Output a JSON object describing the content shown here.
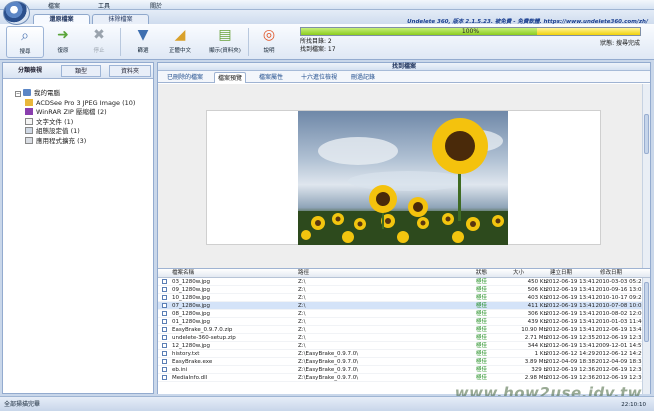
{
  "menu": [
    "檔案",
    "工具",
    "關於"
  ],
  "app_info": "Undelete 360, 版本 2.1.5.23. 被免費 - 免費軟體. https://www.undelete360.com/zh/",
  "tabs": [
    "還原檔案",
    "抹除檔案"
  ],
  "ribbon": {
    "search": "搜尋",
    "recover": "復原",
    "stop": "停止",
    "filter": "篩選",
    "view": "正體中文",
    "folder_structure": "顯示(資料夾)",
    "about": "說明"
  },
  "progress": {
    "percent_label": "100%",
    "value": 1.0
  },
  "status": {
    "folders_label": "所找目錄: 2",
    "files_label": "找到檔案: 17"
  },
  "state_label": "狀態: 搜尋完成",
  "left_panel": {
    "tabs": [
      "分類檢視",
      "類型",
      "資料夾"
    ],
    "tree_root": "我的電腦",
    "tree_items": [
      "ACDSee Pro 3 JPEG Image (10)",
      "WinRAR ZIP 壓縮檔 (2)",
      "文字文件 (1)",
      "組態設定值 (1)",
      "應用程式擴充 (3)"
    ]
  },
  "right_panel": {
    "title": "找到檔案",
    "tabs": [
      "已刪除的檔案",
      "檔案預覽",
      "檔案屬性",
      "十六進位檢視",
      "刪過記錄"
    ]
  },
  "file_list": {
    "columns": [
      "檔案名稱",
      "路徑",
      "狀態",
      "大小",
      "建立日期",
      "修改日期"
    ],
    "rows": [
      [
        "03_1280w.jpg",
        "Z:\\",
        "極佳",
        "450 Kb",
        "2012-06-19 13:41",
        "2010-03-03 05:25"
      ],
      [
        "09_1280w.jpg",
        "Z:\\",
        "極佳",
        "506 Kb",
        "2012-06-19 13:41",
        "2010-09-16 13:03"
      ],
      [
        "10_1280w.jpg",
        "Z:\\",
        "極佳",
        "403 Kb",
        "2012-06-19 13:41",
        "2010-10-17 09:28"
      ],
      [
        "07_1280w.jpg",
        "Z:\\",
        "極佳",
        "411 Kb",
        "2012-06-19 13:41",
        "2010-07-08 10:05"
      ],
      [
        "08_1280w.jpg",
        "Z:\\",
        "極佳",
        "306 Kb",
        "2012-06-19 13:41",
        "2010-08-02 12:00"
      ],
      [
        "01_1280w.jpg",
        "Z:\\",
        "極佳",
        "439 Kb",
        "2012-06-19 13:41",
        "2010-01-03 11:40"
      ],
      [
        "EasyBrake_0.9.7.0.zip",
        "Z:\\",
        "極佳",
        "10.90 Mb",
        "2012-06-19 13:41",
        "2012-06-19 13:41"
      ],
      [
        "undelete-360-setup.zip",
        "Z:\\",
        "極佳",
        "2.71 Mb",
        "2012-06-19 12:35",
        "2012-06-19 12:35"
      ],
      [
        "12_1280w.jpg",
        "Z:\\",
        "極佳",
        "344 Kb",
        "2012-06-19 13:41",
        "2009-12-01 14:59"
      ],
      [
        "history.txt",
        "Z:\\EasyBrake_0.9.7.0\\",
        "極佳",
        "1 Kb",
        "2012-06-12 14:29",
        "2012-06-12 14:29"
      ],
      [
        "EasyBrake.exe",
        "Z:\\EasyBrake_0.9.7.0\\",
        "極佳",
        "3.89 Mb",
        "2012-04-09 18:38",
        "2012-04-09 18:38"
      ],
      [
        "eb.ini",
        "Z:\\EasyBrake_0.9.7.0\\",
        "極佳",
        "329 b",
        "2012-06-19 12:36",
        "2012-06-19 12:36"
      ],
      [
        "MediaInfo.dll",
        "Z:\\EasyBrake_0.9.7.0\\",
        "極佳",
        "2.98 Mb",
        "2012-06-19 12:36",
        "2012-06-19 12:36"
      ]
    ]
  },
  "statusbar": {
    "text": "全部掃描完畢",
    "clock": "22:10:10"
  },
  "watermark": "www.how2use.idv.tw",
  "colors": {
    "accent": "#2b4f8c",
    "status_ok": "#1a8a1a",
    "progress_fill": "#8ccc1e"
  }
}
